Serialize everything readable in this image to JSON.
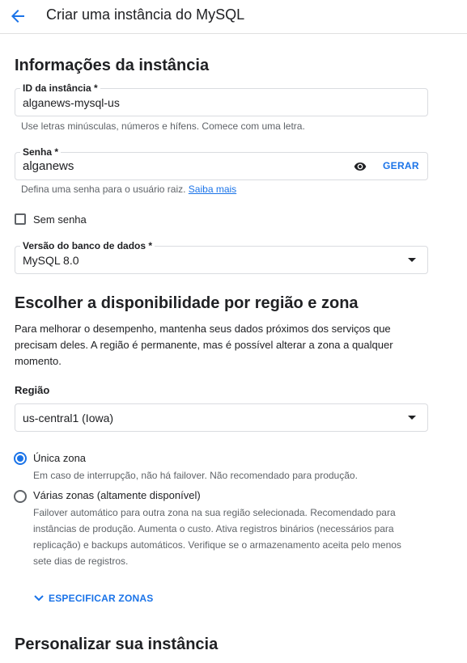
{
  "header": {
    "title": "Criar uma instância do MySQL"
  },
  "instance_info": {
    "section_title": "Informações da instância",
    "instance_id": {
      "label": "ID da instância *",
      "value": "alganews-mysql-us",
      "helper": "Use letras minúsculas, números e hífens. Comece com uma letra."
    },
    "password": {
      "label": "Senha *",
      "value": "alganews",
      "generate_label": "GERAR",
      "helper": "Defina uma senha para o usuário raiz.",
      "helper_link": "Saiba mais"
    },
    "no_password": {
      "label": "Sem senha",
      "checked": false
    },
    "db_version": {
      "label": "Versão do banco de dados *",
      "value": "MySQL 8.0"
    }
  },
  "availability": {
    "section_title": "Escolher a disponibilidade por região e zona",
    "description": "Para melhorar o desempenho, mantenha seus dados próximos dos serviços que precisam deles. A região é permanente, mas é possível alterar a zona a qualquer momento.",
    "region_label": "Região",
    "region_value": "us-central1 (Iowa)",
    "options": [
      {
        "label": "Única zona",
        "description": "Em caso de interrupção, não há failover. Não recomendado para produção.",
        "selected": true
      },
      {
        "label": "Várias zonas (altamente disponível)",
        "description": "Failover automático para outra zona na sua região selecionada. Recomendado para instâncias de produção. Aumenta o custo. Ativa registros binários (necessários para replicação) e backups automáticos. Verifique se o armazenamento aceita pelo menos sete dias de registros.",
        "selected": false
      }
    ],
    "specify_zones_label": "ESPECIFICAR ZONAS"
  },
  "customize": {
    "section_title": "Personalizar sua instância"
  },
  "colors": {
    "accent": "#1a73e8",
    "text": "#202124",
    "secondary_text": "#5f6368",
    "border": "#dadce0"
  },
  "icons": {
    "back": "arrow-back-icon",
    "visibility": "eye-icon",
    "dropdown": "caret-down-icon",
    "expand": "chevron-down-icon"
  }
}
